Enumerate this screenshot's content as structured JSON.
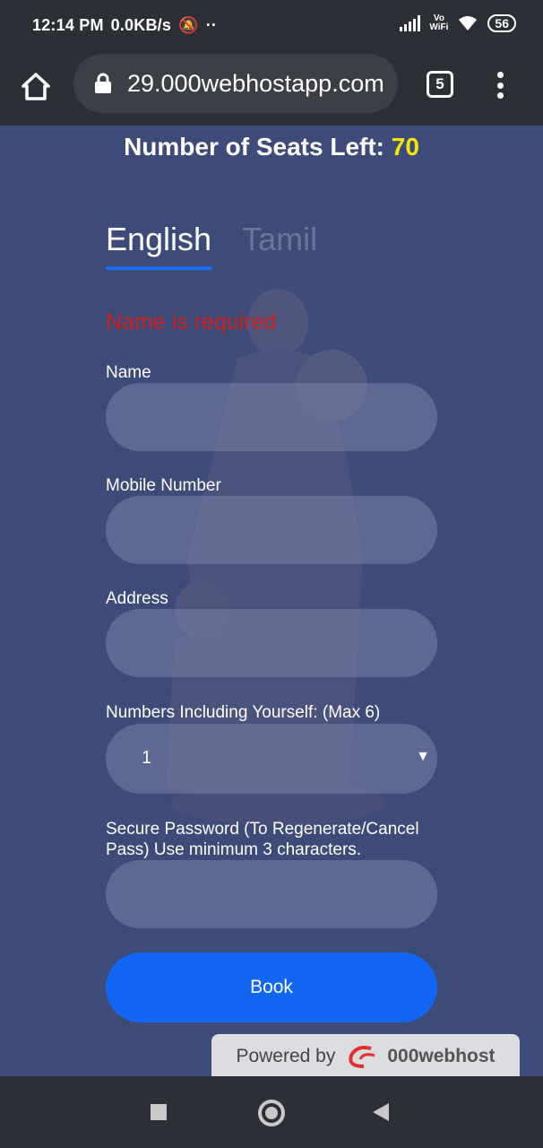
{
  "status_bar": {
    "time": "12:14 PM",
    "speed": "0.0KB/s",
    "mute_icon": "bell-off-icon",
    "dots": "··",
    "vowifi_top": "Vo",
    "vowifi_bottom": "WiFi",
    "battery": "56"
  },
  "browser": {
    "url": "29.000webhostapp.com",
    "tab_count": "5"
  },
  "page": {
    "seats_label": "Number of Seats Left:",
    "seats_count": "70",
    "tabs": [
      {
        "label": "English",
        "active": true
      },
      {
        "label": "Tamil",
        "active": false
      }
    ],
    "error": "Name is required",
    "fields": {
      "name_label": "Name",
      "mobile_label": "Mobile Number",
      "address_label": "Address",
      "count_label": "Numbers Including Yourself: (Max 6)",
      "count_value": "1",
      "password_label": "Secure Password (To Regenerate/Cancel Pass) Use minimum 3 characters."
    },
    "book_label": "Book",
    "powered_by": "Powered by",
    "powered_brand": "000webhost"
  },
  "colors": {
    "page_bg": "#3d4b78",
    "seats_count": "#f4e40c",
    "error": "#d11d1d",
    "button": "#1365f3",
    "tab_underline": "#1a6cf0"
  }
}
